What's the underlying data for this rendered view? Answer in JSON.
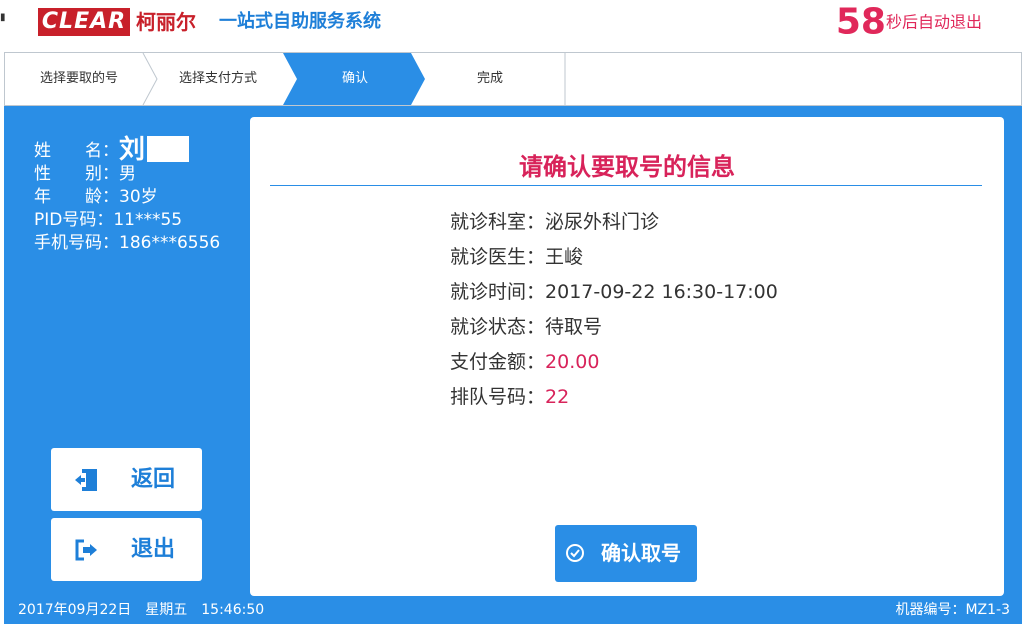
{
  "header": {
    "logo_text": "CLEAR",
    "logo_cn": "柯丽尔",
    "system_title": "一站式自助服务系统",
    "countdown_seconds": "58",
    "countdown_text": "秒后自动退出"
  },
  "steps": [
    {
      "label": "选择要取的号",
      "active": false
    },
    {
      "label": "选择支付方式",
      "active": false
    },
    {
      "label": "确认",
      "active": true
    },
    {
      "label": "完成",
      "active": false
    }
  ],
  "patient": {
    "name_label": "姓　　名：",
    "name_value": "刘",
    "gender_label": "性　　别：",
    "gender_value": "男",
    "age_label": "年　　龄：",
    "age_value": "30岁",
    "pid_label": "PID号码：",
    "pid_value": "11***55",
    "phone_label": "手机号码：",
    "phone_value": "186***6556"
  },
  "buttons": {
    "back": "返回",
    "exit": "退出",
    "confirm": "确认取号"
  },
  "card": {
    "title": "请确认要取号的信息",
    "details": [
      {
        "label": "就诊科室：",
        "value": "泌尿外科门诊",
        "accent": false
      },
      {
        "label": "就诊医生：",
        "value": "王峻",
        "accent": false
      },
      {
        "label": "就诊时间：",
        "value": "2017-09-22 16:30-17:00",
        "accent": false
      },
      {
        "label": "就诊状态：",
        "value": "待取号",
        "accent": false
      },
      {
        "label": "支付金额：",
        "value": "20.00",
        "accent": true
      },
      {
        "label": "排队号码：",
        "value": "22",
        "accent": true
      }
    ]
  },
  "footer": {
    "datetime": "2017年09月22日　星期五　15:46:50",
    "machine": "机器编号：MZ1-3"
  },
  "colors": {
    "primary_blue": "#2a8ee6",
    "accent_pink": "#d8235a",
    "brand_red": "#c8202a"
  }
}
